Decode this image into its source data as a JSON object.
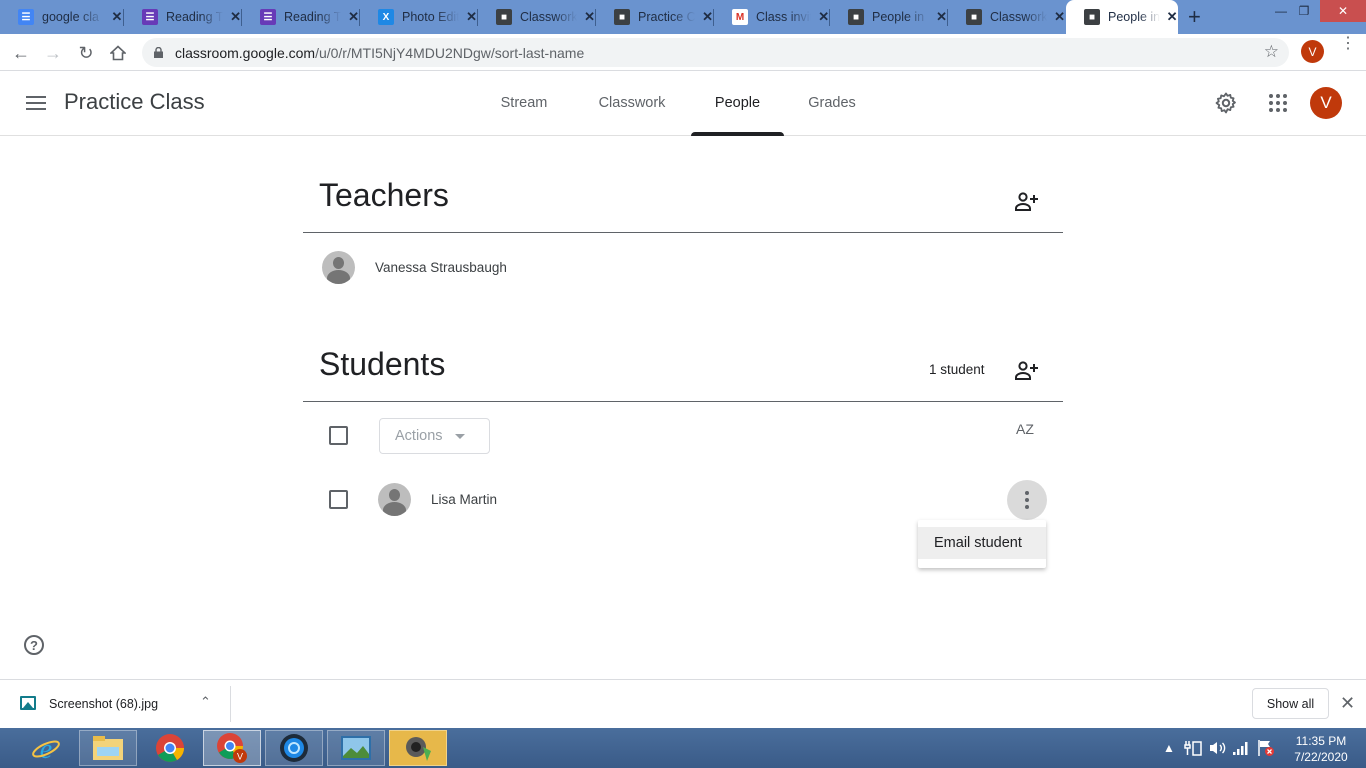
{
  "browser": {
    "tabs": [
      {
        "title": "google cla",
        "icon": "docs-icon",
        "color": "#4285f4",
        "active": false
      },
      {
        "title": "Reading T",
        "icon": "forms-icon",
        "color": "#673ab7",
        "active": false
      },
      {
        "title": "Reading T",
        "icon": "forms-icon",
        "color": "#673ab7",
        "active": false
      },
      {
        "title": "Photo Edit",
        "icon": "photo-editor-icon",
        "color": "#1e88e5",
        "active": false
      },
      {
        "title": "Classwork",
        "icon": "classroom-icon",
        "color": "#3c4043",
        "active": false
      },
      {
        "title": "Practice C",
        "icon": "classroom-icon",
        "color": "#3c4043",
        "active": false
      },
      {
        "title": "Class invit",
        "icon": "gmail-icon",
        "color": "#d93025",
        "active": false
      },
      {
        "title": "People in",
        "icon": "classroom-icon",
        "color": "#3c4043",
        "active": false
      },
      {
        "title": "Classwork",
        "icon": "classroom-icon",
        "color": "#3c4043",
        "active": false
      },
      {
        "title": "People in",
        "icon": "classroom-icon",
        "color": "#3c4043",
        "active": true
      }
    ],
    "url_host": "classroom.google.com",
    "url_path": "/u/0/r/MTI5NjY4MDU2NDgw/sort-last-name",
    "profile_initial": "V"
  },
  "header": {
    "class_name": "Practice Class",
    "tabs": [
      {
        "label": "Stream",
        "active": false
      },
      {
        "label": "Classwork",
        "active": false
      },
      {
        "label": "People",
        "active": true
      },
      {
        "label": "Grades",
        "active": false
      }
    ],
    "avatar_initial": "V"
  },
  "teachers": {
    "title": "Teachers",
    "list": [
      {
        "name": "Vanessa Strausbaugh"
      }
    ]
  },
  "students": {
    "title": "Students",
    "count_label": "1 student",
    "actions_label": "Actions",
    "sort_label": "AZ",
    "list": [
      {
        "name": "Lisa Martin"
      }
    ],
    "menu": {
      "items": [
        "Email student"
      ]
    }
  },
  "downloads": {
    "file_name": "Screenshot (68).jpg",
    "show_all_label": "Show all"
  },
  "taskbar": {
    "time": "11:35 PM",
    "date": "7/22/2020"
  }
}
